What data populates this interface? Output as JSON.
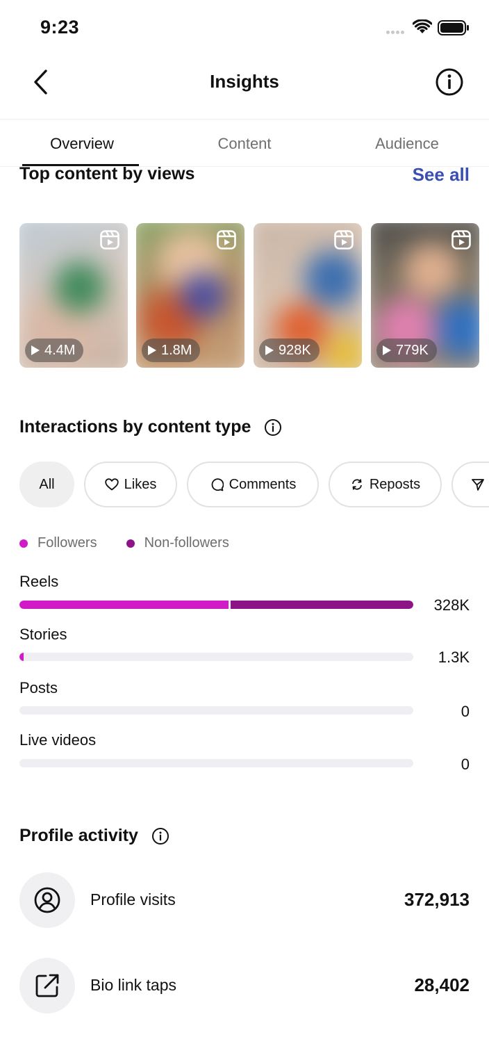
{
  "status_bar": {
    "time": "9:23"
  },
  "header": {
    "title": "Insights"
  },
  "tabs": [
    {
      "label": "Overview",
      "active": true
    },
    {
      "label": "Content",
      "active": false
    },
    {
      "label": "Audience",
      "active": false
    }
  ],
  "top_content": {
    "title": "Top content by views",
    "see_all": "See all",
    "items": [
      {
        "views": "4.4M"
      },
      {
        "views": "1.8M"
      },
      {
        "views": "928K"
      },
      {
        "views": "779K"
      }
    ]
  },
  "interactions": {
    "title": "Interactions by content type",
    "filters": [
      {
        "label": "All",
        "icon": "",
        "selected": true
      },
      {
        "label": "Likes",
        "icon": "heart-icon",
        "selected": false
      },
      {
        "label": "Comments",
        "icon": "comment-icon",
        "selected": false
      },
      {
        "label": "Reposts",
        "icon": "repost-icon",
        "selected": false
      },
      {
        "label": "",
        "icon": "share-icon",
        "selected": false
      }
    ],
    "legend": [
      {
        "label": "Followers",
        "color": "#d11bc7"
      },
      {
        "label": "Non-followers",
        "color": "#8c1486"
      }
    ],
    "rows": [
      {
        "label": "Reels",
        "value": "328K",
        "followers_fraction": 0.53,
        "nonfollowers_fraction": 0.47
      },
      {
        "label": "Stories",
        "value": "1.3K",
        "followers_fraction": 0.01,
        "nonfollowers_fraction": 0.0
      },
      {
        "label": "Posts",
        "value": "0",
        "followers_fraction": 0.0,
        "nonfollowers_fraction": 0.0
      },
      {
        "label": "Live videos",
        "value": "0",
        "followers_fraction": 0.0,
        "nonfollowers_fraction": 0.0
      }
    ]
  },
  "profile_activity": {
    "title": "Profile activity",
    "rows": [
      {
        "label": "Profile visits",
        "value": "372,913",
        "icon": "profile-icon"
      },
      {
        "label": "Bio link taps",
        "value": "28,402",
        "icon": "external-link-icon"
      }
    ]
  }
}
